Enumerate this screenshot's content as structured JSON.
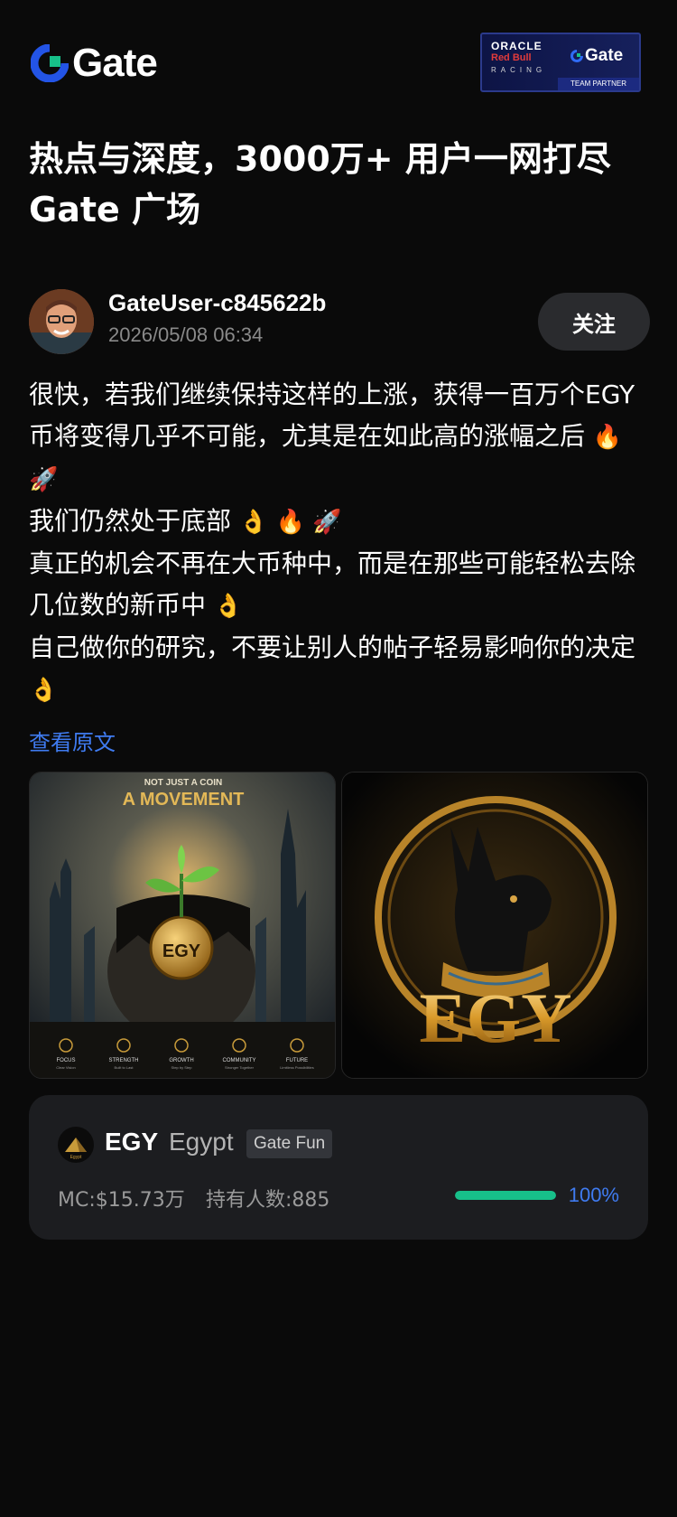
{
  "header": {
    "brand": "Gate",
    "partner": {
      "line1": "ORACLE",
      "line2": "Red Bull",
      "line3": "RACING",
      "brand": "Gate",
      "tag": "TEAM PARTNER"
    }
  },
  "headline": {
    "line1": "热点与深度，3000万+ 用户一网打尽",
    "line2": "Gate 广场"
  },
  "author": {
    "name": "GateUser-c845622b",
    "date": "2026/05/08 06:34",
    "follow_label": "关注"
  },
  "post": {
    "lines": [
      "很快，若我们继续保持这样的上涨，获得一百万个EGY币将变得几乎不可能，尤其是在如此高的涨幅之后",
      "我们仍然处于底部",
      "真正的机会不再在大币种中，而是在那些可能轻松去除几位数的新币中",
      "自己做你的研究，不要让别人的帖子轻易影响你的决定"
    ],
    "emojis": [
      "🔥 🚀",
      "👌 🔥 🚀",
      "👌",
      "👌"
    ],
    "view_original": "查看原文"
  },
  "images": {
    "img1": {
      "top": "NOT JUST A COIN",
      "title": "A MOVEMENT",
      "coin": "EGY",
      "pillars": [
        {
          "name": "FOCUS",
          "sub": "Clear Vision"
        },
        {
          "name": "STRENGTH",
          "sub": "Built to Last"
        },
        {
          "name": "GROWTH",
          "sub": "Step by Step"
        },
        {
          "name": "COMMUNITY",
          "sub": "Stronger Together"
        },
        {
          "name": "FUTURE",
          "sub": "Limitless Possibilities"
        }
      ]
    },
    "img2": {
      "title": "EGY"
    }
  },
  "token": {
    "icon_text": "Egypt",
    "ticker": "EGY",
    "name": "Egypt",
    "tag": "Gate Fun",
    "mc": "MC:$15.73万",
    "holders": "持有人数:885",
    "progress": 1.0,
    "progress_label": "100%",
    "colors": {
      "progress": "#17c08a",
      "accent": "#3f7bf0"
    }
  }
}
